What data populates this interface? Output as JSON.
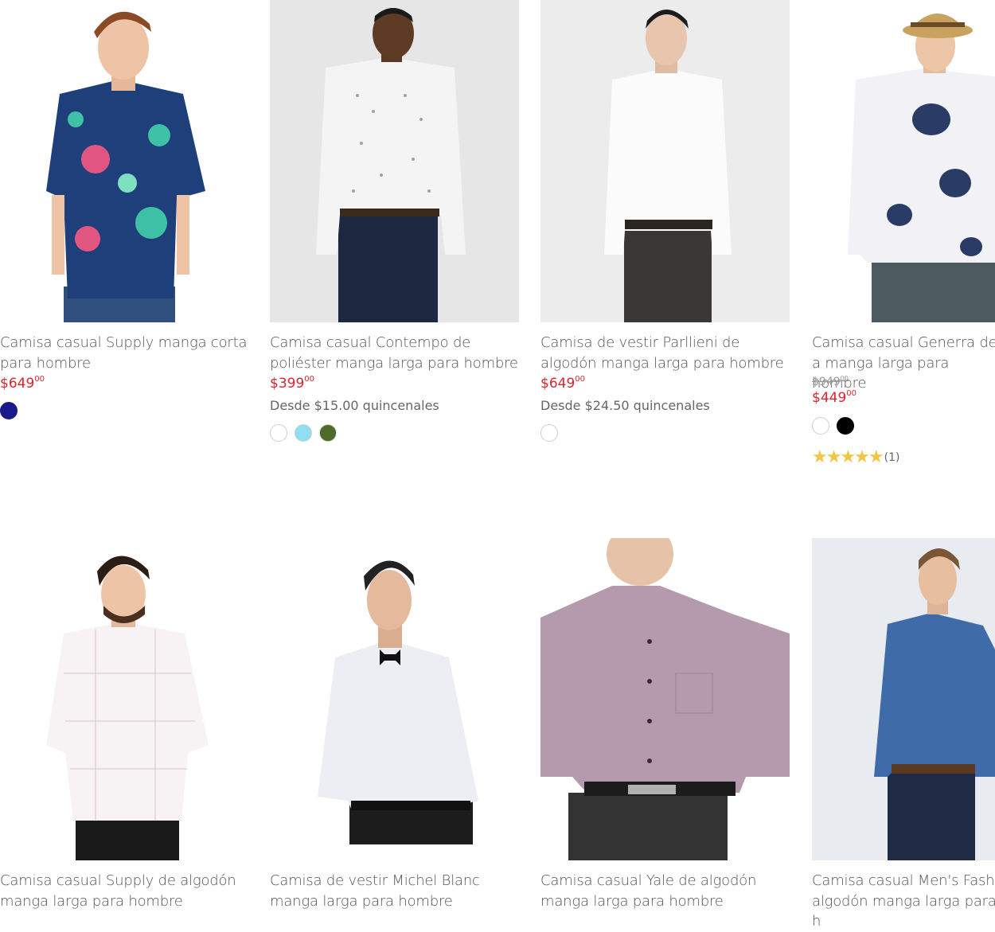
{
  "colors": {
    "price": "#d7262d",
    "star": "#f4c542"
  },
  "products": [
    {
      "title": "Camisa casual Supply manga corta para hombre",
      "price_main": "$649",
      "price_cents": "00",
      "old_price_main": "",
      "old_price_cents": "",
      "installment": "",
      "swatches": [
        "#1a1a8c"
      ],
      "rating": "",
      "rating_count": ""
    },
    {
      "title": "Camisa casual Contempo de poliéster manga larga para hombre",
      "price_main": "$399",
      "price_cents": "00",
      "old_price_main": "",
      "old_price_cents": "",
      "installment": "Desde $15.00 quincenales",
      "swatches": [
        "#ffffff",
        "#8fdff0",
        "#4d6b2a"
      ],
      "rating": "",
      "rating_count": ""
    },
    {
      "title": "Camisa de vestir Parllieni de algodón manga larga para hombre",
      "price_main": "$649",
      "price_cents": "00",
      "old_price_main": "",
      "old_price_cents": "",
      "installment": "Desde $24.50 quincenales",
      "swatches": [
        "#ffffff"
      ],
      "rating": "",
      "rating_count": ""
    },
    {
      "title": "Camisa casual Generra de a manga larga para hombre",
      "price_main": "$449",
      "price_cents": "00",
      "old_price_main": "$949",
      "old_price_cents": "00",
      "installment": "",
      "swatches": [
        "#ffffff",
        "#000000"
      ],
      "rating": "★★★★★",
      "rating_count": "(1)"
    },
    {
      "title": "Camisa casual Supply de algodón manga larga para hombre",
      "price_main": "",
      "price_cents": "",
      "old_price_main": "",
      "old_price_cents": "",
      "installment": "",
      "swatches": [],
      "rating": "",
      "rating_count": ""
    },
    {
      "title": "Camisa de vestir Michel Blanc manga larga para hombre",
      "price_main": "",
      "price_cents": "",
      "old_price_main": "",
      "old_price_cents": "",
      "installment": "",
      "swatches": [],
      "rating": "",
      "rating_count": ""
    },
    {
      "title": "Camisa casual Yale de algodón manga larga para hombre",
      "price_main": "",
      "price_cents": "",
      "old_price_main": "",
      "old_price_cents": "",
      "installment": "",
      "swatches": [],
      "rating": "",
      "rating_count": ""
    },
    {
      "title": "Camisa casual Men's Fashi algodón manga larga para h",
      "price_main": "",
      "price_cents": "",
      "old_price_main": "",
      "old_price_cents": "",
      "installment": "",
      "swatches": [],
      "rating": "",
      "rating_count": ""
    }
  ]
}
